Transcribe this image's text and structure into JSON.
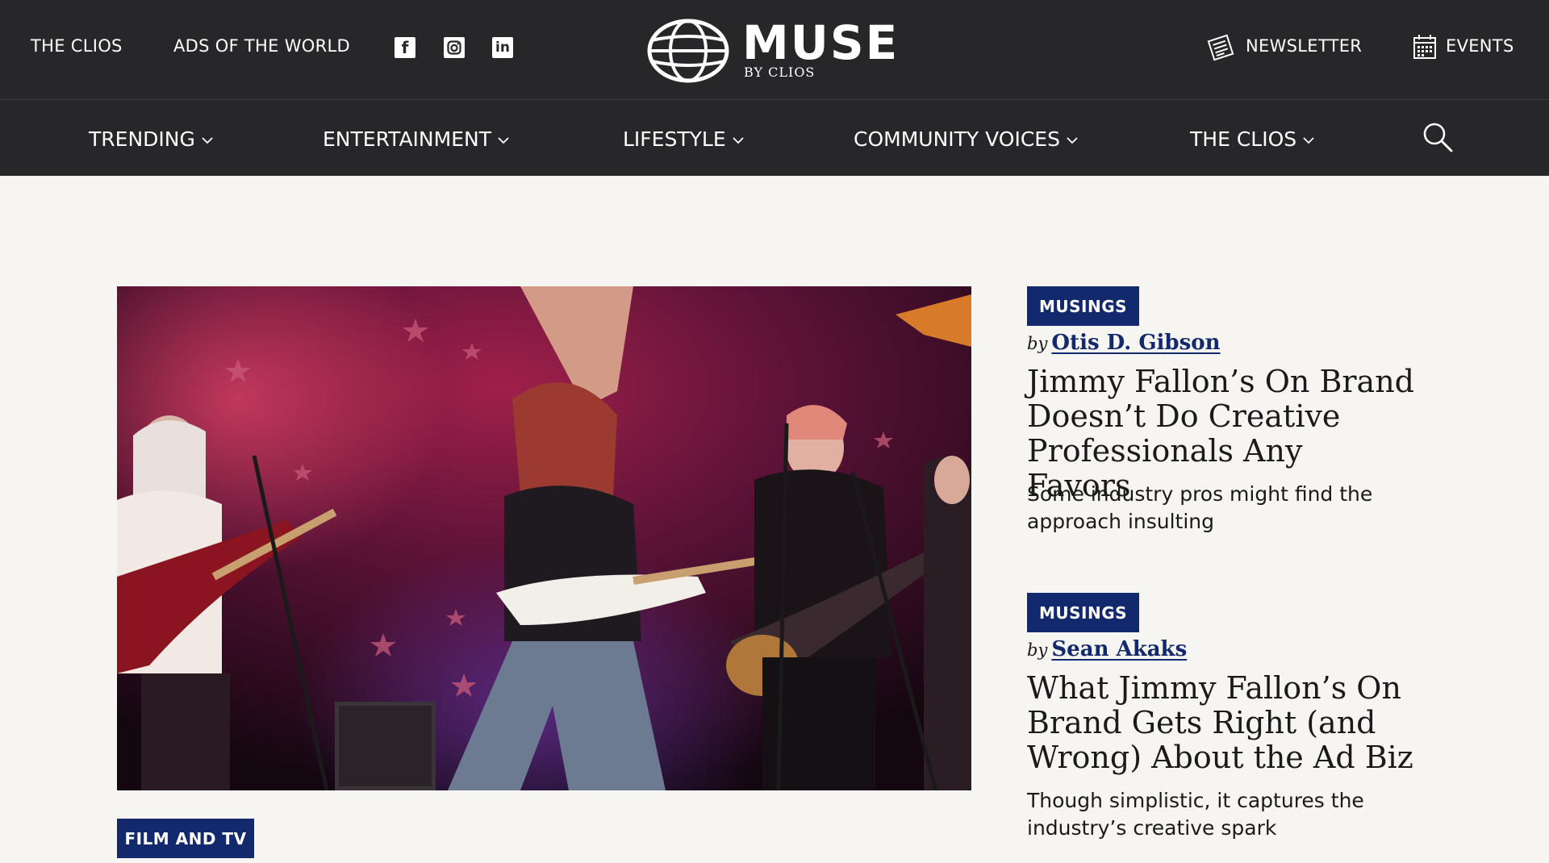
{
  "top_bar": {
    "left_links": [
      "THE CLIOS",
      "ADS OF THE WORLD"
    ],
    "social_icons": [
      "facebook-icon",
      "instagram-icon",
      "linkedin-icon"
    ],
    "logo": {
      "word": "MUSE",
      "sub": "BY CLIOS"
    },
    "right_links": [
      {
        "label": "NEWSLETTER",
        "icon": "newspaper-icon"
      },
      {
        "label": "EVENTS",
        "icon": "calendar-icon"
      }
    ]
  },
  "nav": {
    "items": [
      "TRENDING",
      "ENTERTAINMENT",
      "LIFESTYLE",
      "COMMUNITY VOICES",
      "THE CLIOS"
    ],
    "search_icon": "search-icon"
  },
  "hero": {
    "tag": "FILM AND TV"
  },
  "articles": [
    {
      "tag": "MUSINGS",
      "by": "by",
      "author": "Otis D. Gibson",
      "headline": "Jimmy Fallon’s On Brand Doesn’t Do Creative Professionals Any Favors",
      "dek": "Some industry pros might find the approach insulting"
    },
    {
      "tag": "MUSINGS",
      "by": "by",
      "author": "Sean Akaks",
      "headline": "What Jimmy Fallon’s On Brand Gets Right (and Wrong) About the Ad Biz",
      "dek": "Though simplistic, it captures the industry’s creative spark"
    }
  ],
  "colors": {
    "header_bg": "#272729",
    "page_bg": "#f7f5f2",
    "tag_bg": "#13296e",
    "author_link": "#13296e"
  }
}
